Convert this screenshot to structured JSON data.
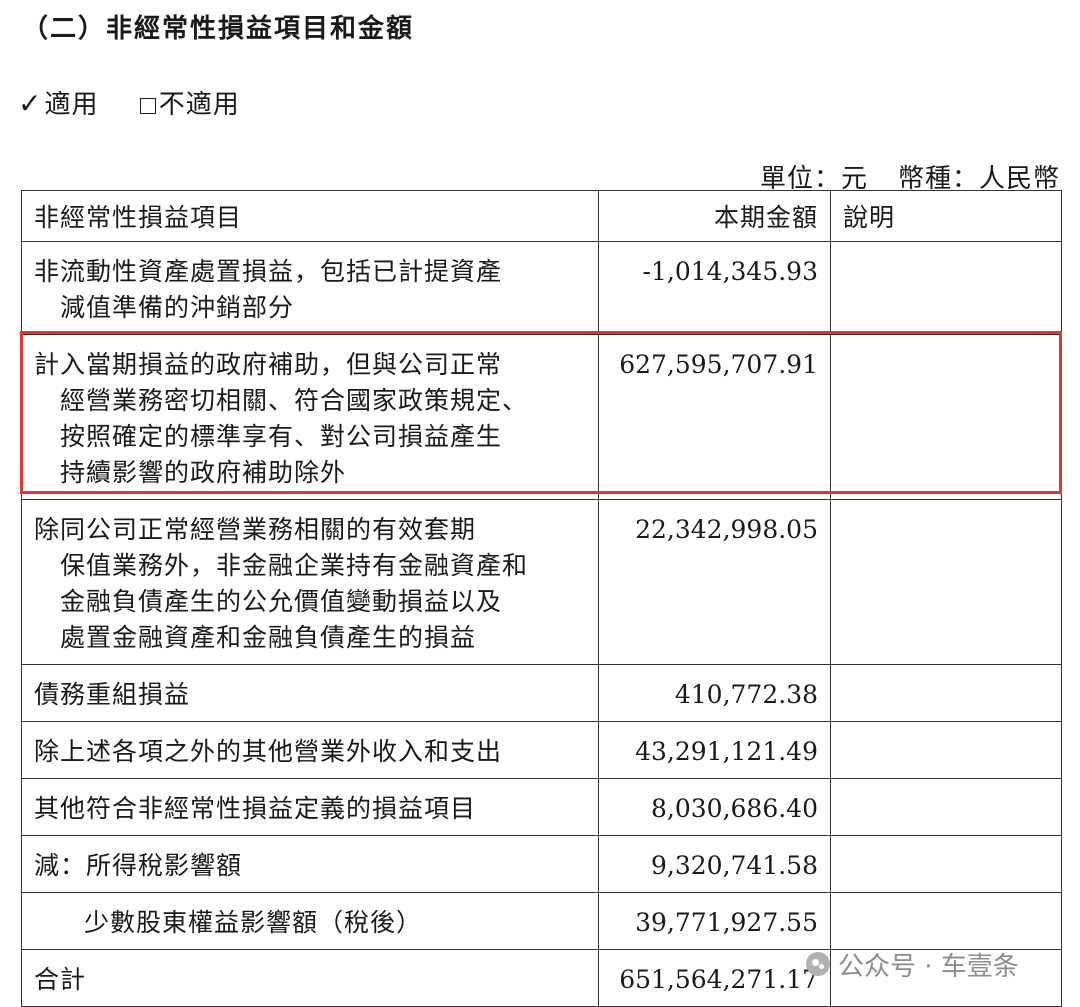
{
  "section_title": "（二）非經常性損益項目和金額",
  "applicability": {
    "check_mark": "✓",
    "applicable_label": "適用",
    "not_applicable_label": "不適用"
  },
  "unit_line": {
    "unit": "單位：元",
    "currency": "幣種：人民幣"
  },
  "table": {
    "headers": {
      "item": "非經常性損益項目",
      "amount": "本期金額",
      "note": "說明"
    },
    "rows": [
      {
        "lines": [
          "非流動性資產處置損益，包括已計提資產",
          "減值準備的沖銷部分"
        ],
        "amount": "-1,014,345.93",
        "note": ""
      },
      {
        "lines": [
          "計入當期損益的政府補助，但與公司正常",
          "經營業務密切相關、符合國家政策規定、",
          "按照確定的標準享有、對公司損益產生",
          "持續影響的政府補助除外"
        ],
        "amount": "627,595,707.91",
        "note": ""
      },
      {
        "lines": [
          "除同公司正常經營業務相關的有效套期",
          "保值業務外，非金融企業持有金融資產和",
          "金融負債產生的公允價值變動損益以及",
          "處置金融資產和金融負債產生的損益"
        ],
        "amount": "22,342,998.05",
        "note": ""
      },
      {
        "lines": [
          "債務重組損益"
        ],
        "amount": "410,772.38",
        "note": ""
      },
      {
        "lines": [
          "除上述各項之外的其他營業外收入和支出"
        ],
        "amount": "43,291,121.49",
        "note": ""
      },
      {
        "lines": [
          "其他符合非經常性損益定義的損益項目"
        ],
        "amount": "8,030,686.40",
        "note": ""
      },
      {
        "lines": [
          "減：所得稅影響額"
        ],
        "amount": "9,320,741.58",
        "note": ""
      },
      {
        "lines": [
          "少數股東權益影響額（稅後）"
        ],
        "amount": "39,771,927.55",
        "note": ""
      },
      {
        "lines": [
          "合計"
        ],
        "amount": "651,564,271.17",
        "note": ""
      }
    ]
  },
  "highlight_color": "#e8332e",
  "watermark": {
    "icon": "wechat-official-account-icon",
    "text": "公众号 · 车壹条"
  }
}
